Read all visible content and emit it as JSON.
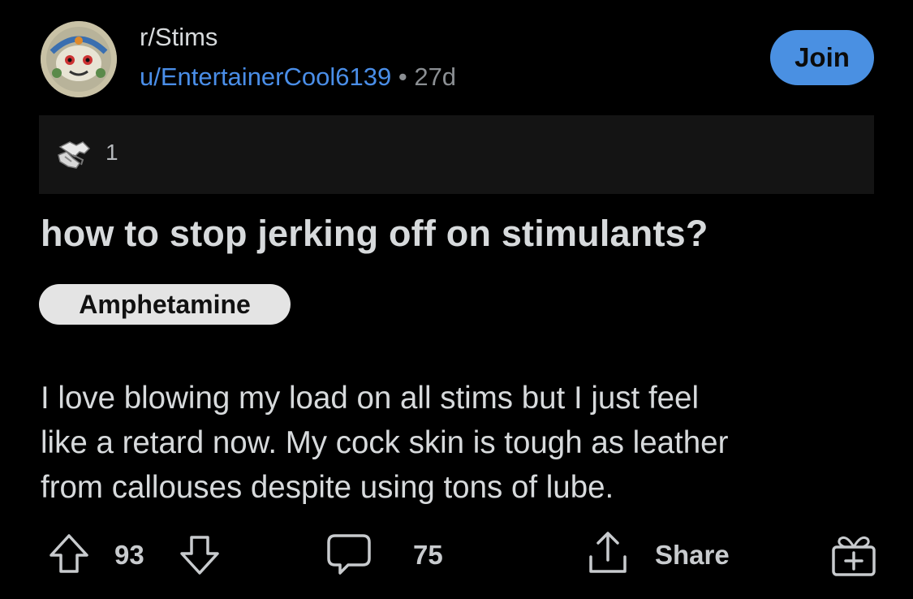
{
  "post": {
    "subreddit": "r/Stims",
    "author": "u/EntertainerCool6139",
    "separator": "•",
    "age": "27d",
    "join_label": "Join",
    "award_count": "1",
    "title": "how to stop jerking off on stimulants?",
    "flair": "Amphetamine",
    "body_lines": [
      "I love blowing my load on all stims but I just feel",
      "like a retard now.  My cock skin is tough as leather",
      "from callouses despite using tons of lube."
    ]
  },
  "actions": {
    "upvotes": "93",
    "comments": "75",
    "share_label": "Share"
  },
  "icons": {
    "upvote": "upvote-arrow-icon",
    "downvote": "downvote-arrow-icon",
    "comment": "comment-bubble-icon",
    "share": "share-icon",
    "award": "award-handshake-icon",
    "gift": "gift-award-icon"
  },
  "colors": {
    "background": "#000000",
    "link_blue": "#4a8ee8",
    "join_button": "#4a90e2",
    "flair_bg": "#e4e4e4",
    "award_bar_bg": "#141414"
  }
}
